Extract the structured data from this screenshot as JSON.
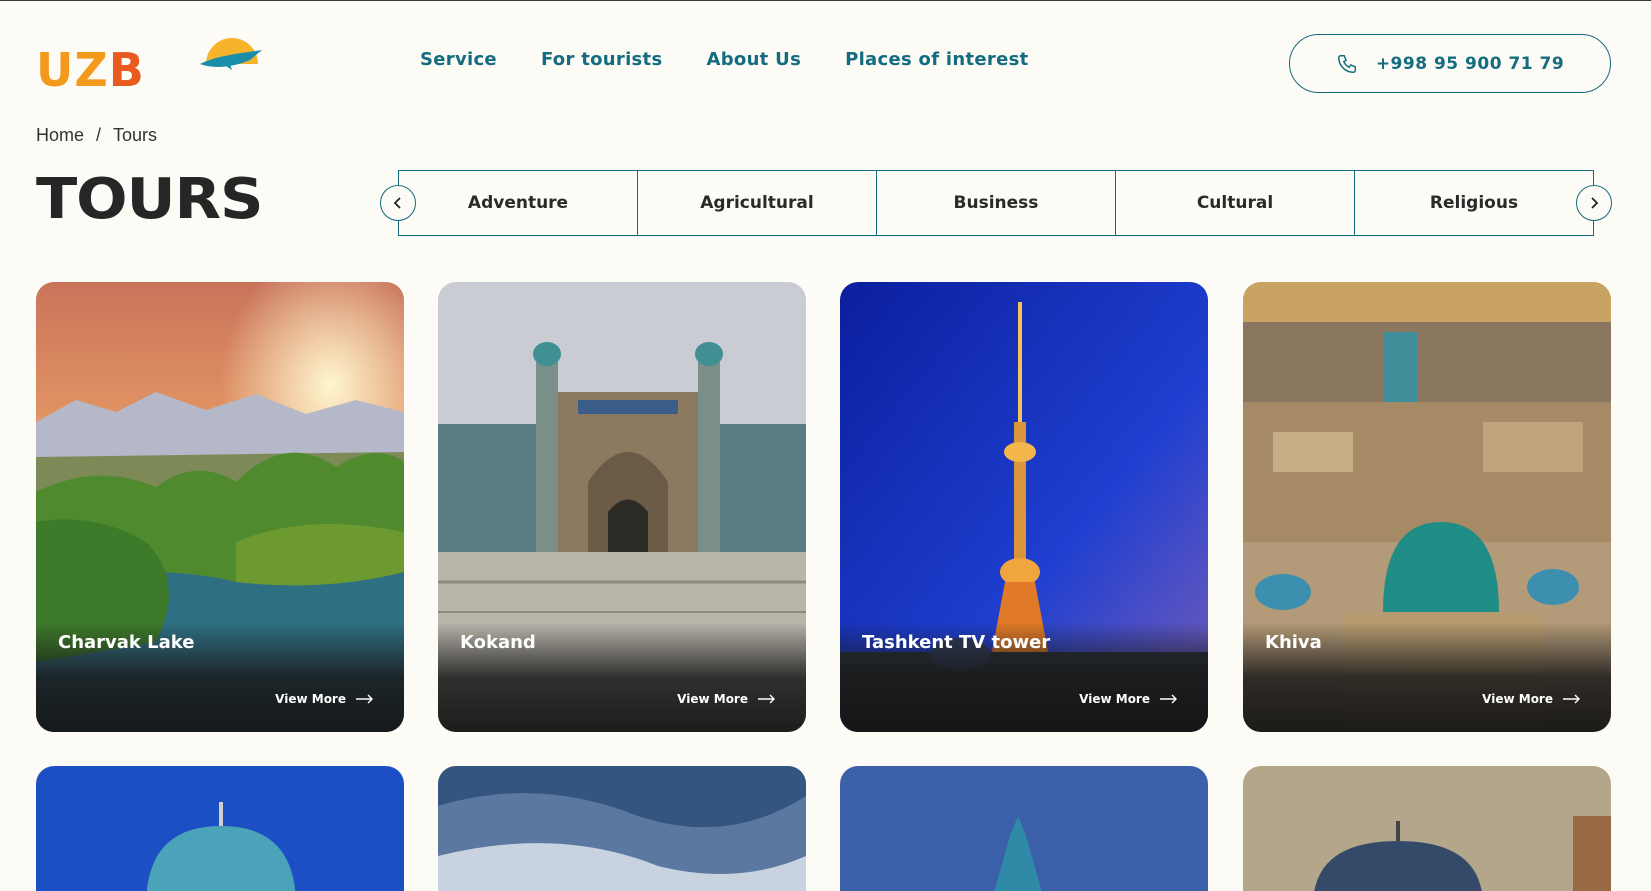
{
  "logo": {
    "text_u": "UZ",
    "text_b": "B"
  },
  "nav": {
    "items": [
      "Service",
      "For tourists",
      "About Us",
      "Places of interest"
    ]
  },
  "phone": {
    "number": "+998 95 900 71 79"
  },
  "breadcrumb": {
    "home": "Home",
    "separator": "/",
    "current": "Tours"
  },
  "page": {
    "title": "TOURS"
  },
  "tabs": [
    "Adventure",
    "Agricultural",
    "Business",
    "Cultural",
    "Religious"
  ],
  "cards": [
    {
      "name": "Charvak Lake",
      "cta": "View More"
    },
    {
      "name": "Kokand",
      "cta": "View More"
    },
    {
      "name": "Tashkent TV tower",
      "cta": "View More"
    },
    {
      "name": "Khiva",
      "cta": "View More"
    }
  ],
  "colors": {
    "accent": "#146c80",
    "background": "#fdfbf5",
    "logo_orange": "#f39a1d",
    "logo_red": "#e85a1d"
  }
}
